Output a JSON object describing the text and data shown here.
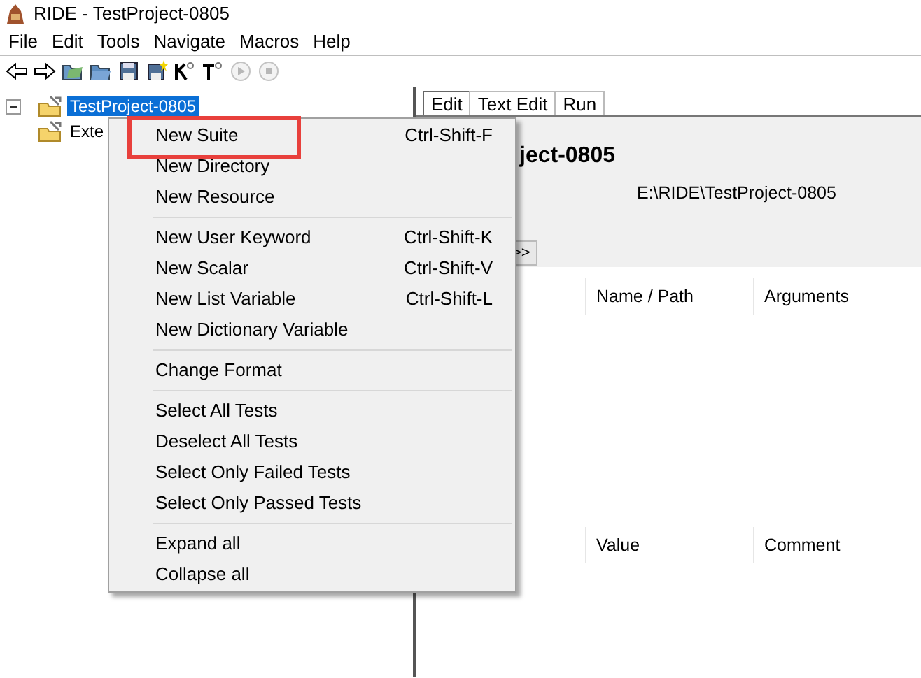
{
  "window": {
    "title": "RIDE - TestProject-0805"
  },
  "menubar": [
    "File",
    "Edit",
    "Tools",
    "Navigate",
    "Macros",
    "Help"
  ],
  "toolbar": [
    {
      "kind": "back",
      "disabled": false
    },
    {
      "kind": "forward",
      "disabled": false
    },
    {
      "kind": "open-directory",
      "disabled": false
    },
    {
      "kind": "open",
      "disabled": false
    },
    {
      "kind": "save",
      "disabled": false
    },
    {
      "kind": "save-all",
      "disabled": false
    },
    {
      "kind": "search-keyword",
      "disabled": false
    },
    {
      "kind": "search-test",
      "disabled": false
    },
    {
      "kind": "run",
      "disabled": true
    },
    {
      "kind": "stop",
      "disabled": true
    }
  ],
  "tree": [
    {
      "label": "TestProject-0805",
      "selected": true,
      "expanded": true
    },
    {
      "label": "Exte",
      "selected": false
    }
  ],
  "editor": {
    "tabs": [
      {
        "label": "Edit",
        "selected": true
      },
      {
        "label": "Text Edit",
        "selected": false
      },
      {
        "label": "Run",
        "selected": false
      }
    ],
    "heading": "ject-0805",
    "source": "E:\\RIDE\\TestProject-0805",
    "more_button": ">>",
    "tables": [
      {
        "columns": [
          "Name / Path",
          "Arguments"
        ]
      },
      {
        "columns": [
          "Value",
          "Comment"
        ]
      }
    ]
  },
  "context_menu": {
    "groups": [
      [
        {
          "label": "New Suite",
          "shortcut": "Ctrl-Shift-F",
          "annotated": true
        },
        {
          "label": "New Directory",
          "annotated": false
        },
        {
          "label": "New Resource",
          "annotated": false
        }
      ],
      [
        {
          "label": "New User Keyword",
          "shortcut": "Ctrl-Shift-K",
          "annotated": false
        },
        {
          "label": "New Scalar",
          "shortcut": "Ctrl-Shift-V",
          "annotated": false
        },
        {
          "label": "New List Variable",
          "shortcut": "Ctrl-Shift-L",
          "annotated": false
        },
        {
          "label": "New Dictionary Variable",
          "annotated": false
        }
      ],
      [
        {
          "label": "Change Format",
          "annotated": false
        }
      ],
      [
        {
          "label": "Select All Tests",
          "annotated": false
        },
        {
          "label": "Deselect All Tests",
          "annotated": false
        },
        {
          "label": "Select Only Failed Tests",
          "annotated": false
        },
        {
          "label": "Select Only Passed Tests",
          "annotated": false
        }
      ],
      [
        {
          "label": "Expand all",
          "annotated": false
        },
        {
          "label": "Collapse all",
          "annotated": false
        }
      ]
    ]
  }
}
